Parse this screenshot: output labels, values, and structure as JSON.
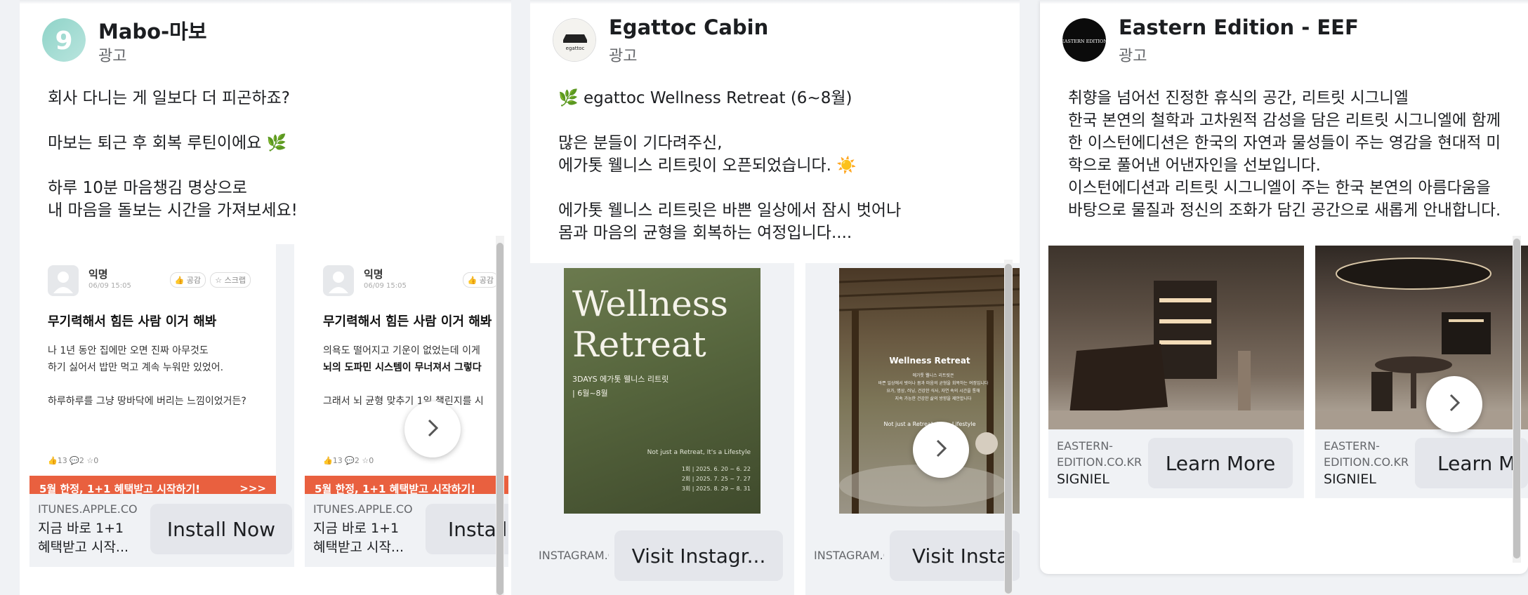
{
  "colors": {
    "banner_orange": "#e9603f",
    "cta_grey": "#e4e6eb",
    "muted": "#65676b",
    "retreat_green": "#56653d"
  },
  "cards": [
    {
      "page_name": "Mabo-마보",
      "sponsored": "광고",
      "body": "회사 다니는 게 일보다 더 피곤하죠?\n\n마보는 퇴근 후 회복 루틴이에요 🌿\n\n하루 10분 마음챙김 명상으로\n내 마음을 돌보는 시간을 가져보세요!",
      "slides": [
        {
          "post": {
            "user": "익명",
            "date": "06/09 15:05",
            "like_btn": "공감",
            "scrap_btn": "스크랩",
            "heading": "무기력해서 힘든 사람 이거 해봐",
            "body": "나 1년 동안 집에만 오면 진짜 아무것도\n하기 싫어서 밥만 먹고 계속 누워만 있었어.\n\n하루하루를 그냥 땅바닥에 버리는 느낌이었거든?",
            "reacts": "👍13  💬2  ☆0",
            "banner": "5월 한정, 1+1 혜택받고 시작하기!",
            "banner_arrow": ">>>"
          },
          "domain": "ITUNES.APPLE.CO",
          "title": "지금 바로 1+1 혜택받고 시작...",
          "cta": "Install Now"
        },
        {
          "post": {
            "user": "익명",
            "date": "06/09 15:05",
            "like_btn": "공감",
            "heading": "무기력해서 힘든 사람 이거 해봐",
            "body_1": "의욕도 떨어지고 기운이 없었는데 이게",
            "body_2": "뇌의 도파민 시스템이 무너져서 그렇다",
            "body_3": "그래서 뇌 균형 맞추기 1일 챌린지를 시",
            "reacts": "👍13  💬2  ☆0",
            "banner": "5월 한정, 1+1 혜택받고 시작하기!"
          },
          "domain": "ITUNES.APPLE.CO",
          "title": "지금 바로 1+1 혜택받고 시작...",
          "cta": "Install N"
        }
      ]
    },
    {
      "page_name": "Egattoc Cabin",
      "sponsored": "광고",
      "logo_text": "egattoc",
      "body": "🌿 egattoc Wellness Retreat (6~8월)\n\n많은 분들이 기다려주신,\n에가톳 웰니스 리트릿이 오픈되었습니다. ☀️\n\n에가톳 웰니스 리트릿은 바쁜 일상에서 잠시 벗어나\n몸과 마음의 균형을 회복하는 여정입니다....",
      "slides": [
        {
          "poster": {
            "title": "Wellness\nRetreat",
            "subtitle": "3DAYS 에가톳 웰니스 리트릿",
            "dates": "| 6월~8월",
            "tagline": "Not just a Retreat, It's a Lifestyle",
            "schedule": "1회 | 2025. 6. 20 ~ 6. 22\n2회 | 2025. 7. 25 ~ 7. 27\n3회 | 2025. 8. 29 ~ 8. 31"
          },
          "domain": "INSTAGRAM.C",
          "cta": "Visit Instagr..."
        },
        {
          "photo": {
            "title": "Wellness Retreat",
            "desc": "에가톳 웰니스 리트릿은\n바쁜 일상에서 벗어나 몸과 마음의 균형을 회복하는 여정입니다\n요가, 명상, 러닝, 건강한 식사, 자연 속의 시간을 통해\n지속 가능한 건강한 삶의 방향을 제안합니다",
            "tagline": "Not just a Retreat, It's a Lifestyle"
          },
          "domain": "INSTAGRAM.C",
          "cta": "Visit Insta"
        }
      ]
    },
    {
      "page_name": "Eastern Edition - EEF",
      "sponsored": "광고",
      "logo_text": "EASTERN EDITION",
      "body": "취향을 넘어선 진정한 휴식의 공간, 리트릿 시그니엘\n한국 본연의 철학과 고차원적 감성을 담은 리트릿 시그니엘에 함께\n한 이스턴에디션은 한국의 자연과 물성들이 주는 영감을 현대적 미\n학으로 풀어낸 어낸자인을 선보입니다.\n이스턴에디션과 리트릿 시그니엘이 주는 한국 본연의 아름다움을\n바탕으로 물질과 정신의 조화가 담긴 공간으로 새롭게 안내합니다.",
      "slides": [
        {
          "domain": "EASTERN-EDITION.CO.KR",
          "title": "SIGNIEL",
          "cta": "Learn More"
        },
        {
          "domain": "EASTERN-EDITION.CO.KR",
          "title": "SIGNIEL",
          "cta": "Learn M"
        }
      ]
    }
  ]
}
